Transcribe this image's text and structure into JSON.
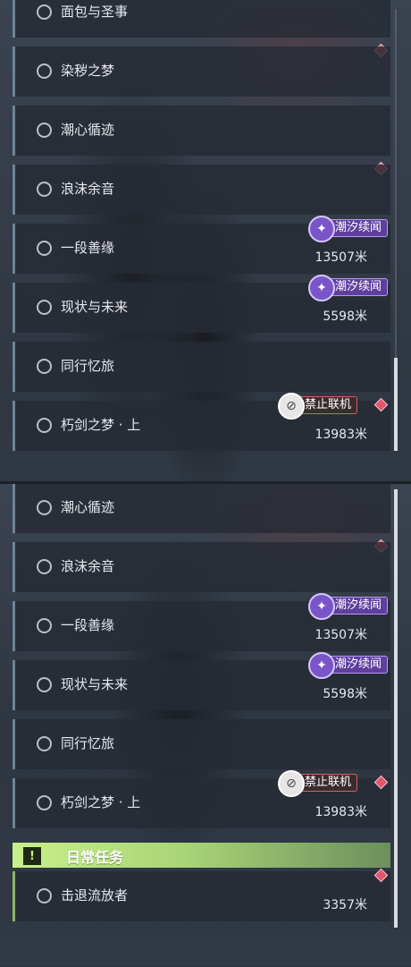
{
  "top_list": {
    "items": [
      {
        "title": "面包与圣事"
      },
      {
        "title": "染秽之梦"
      },
      {
        "title": "潮心循迹"
      },
      {
        "title": "浪沫余音"
      },
      {
        "title": "一段善缘",
        "badge": "潮汐续闻",
        "distance": "13507米"
      },
      {
        "title": "现状与未来",
        "badge": "潮汐续闻",
        "distance": "5598米"
      },
      {
        "title": "同行忆旅"
      },
      {
        "title": "朽剑之梦 · 上",
        "badge": "禁止联机",
        "distance": "13983米"
      }
    ]
  },
  "bottom_list": {
    "items": [
      {
        "title": "潮心循迹"
      },
      {
        "title": "浪沫余音"
      },
      {
        "title": "一段善缘",
        "badge": "潮汐续闻",
        "distance": "13507米"
      },
      {
        "title": "现状与未来",
        "badge": "潮汐续闻",
        "distance": "5598米"
      },
      {
        "title": "同行忆旅"
      },
      {
        "title": "朽剑之梦 · 上",
        "badge": "禁止联机",
        "distance": "13983米"
      }
    ],
    "daily_section": {
      "title": "日常任务",
      "icon": "alert-icon",
      "items": [
        {
          "title": "击退流放者",
          "distance": "3357米"
        }
      ]
    }
  },
  "colors": {
    "tide_badge": "#5e3f9e",
    "no_coop_badge": "#c0524c",
    "tracked_marker": "#e0566b",
    "daily_accent": "#a9d577",
    "row_accent": "#6f8496"
  }
}
